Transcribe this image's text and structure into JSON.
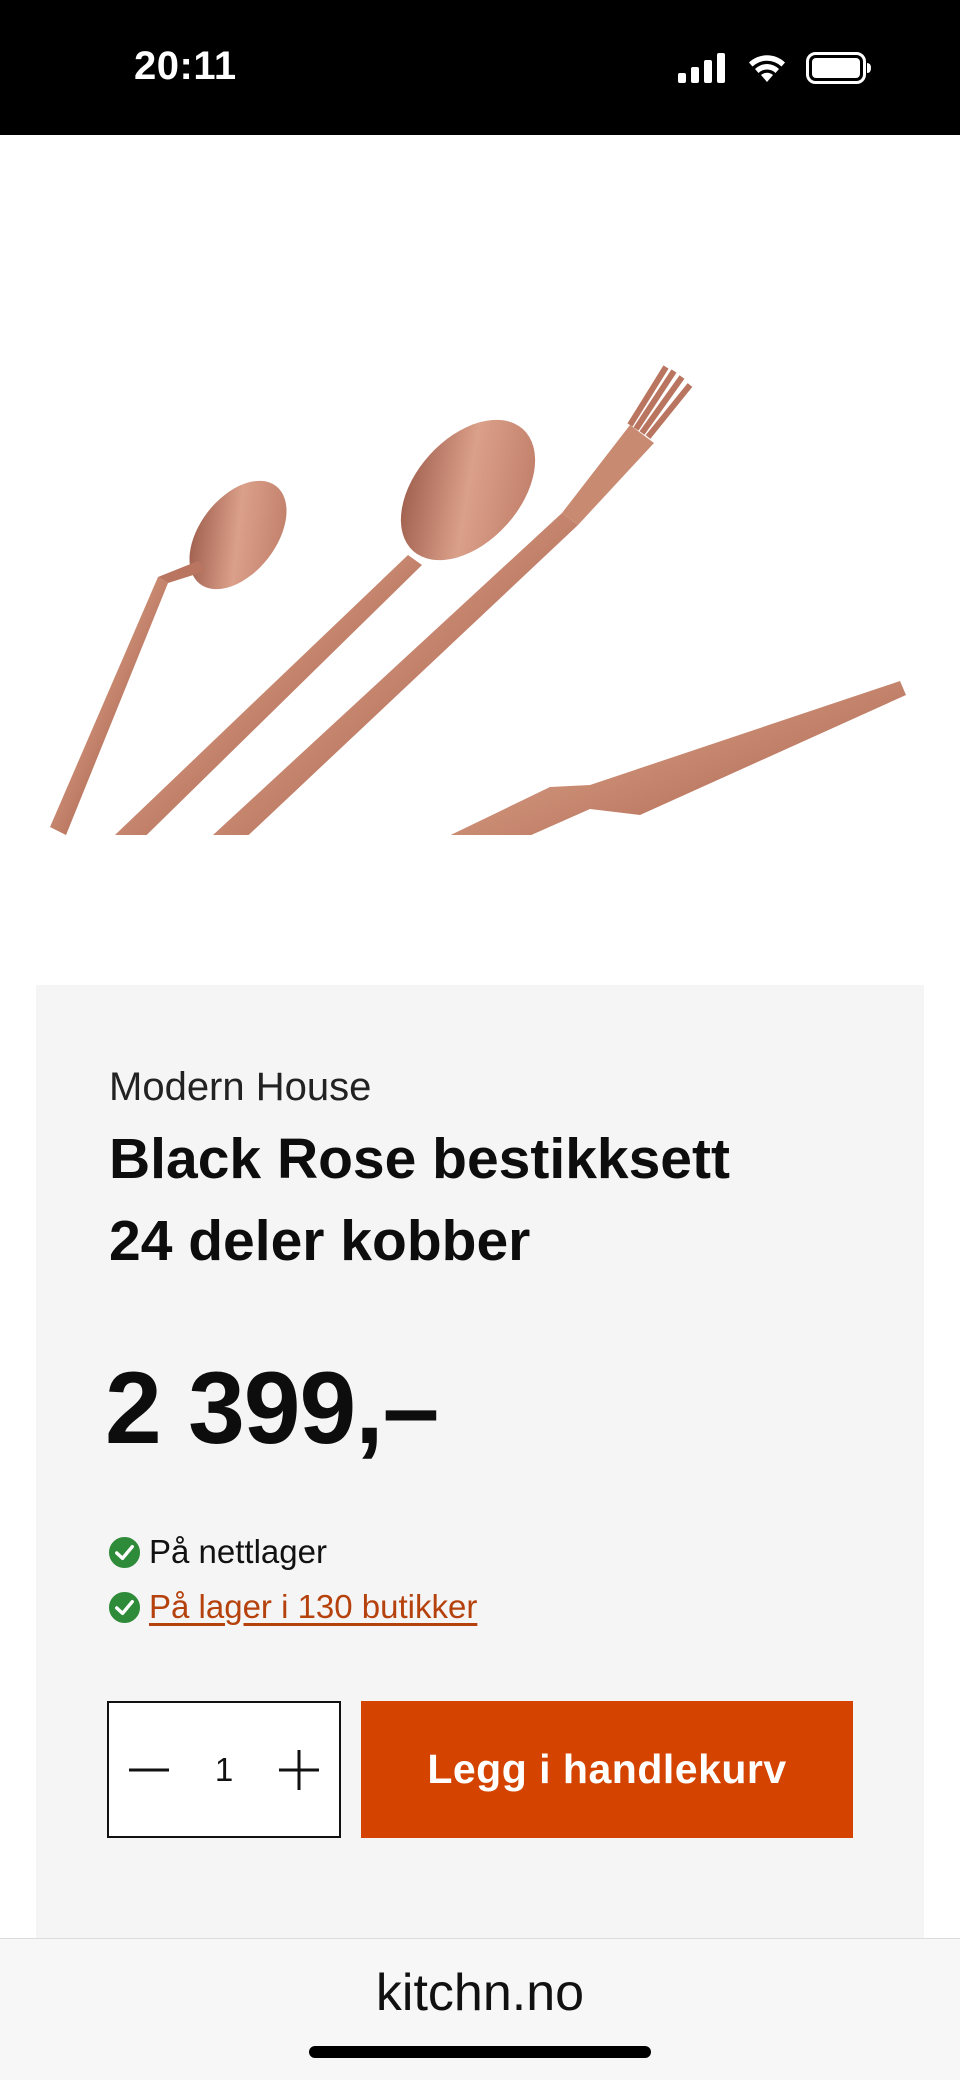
{
  "status_bar": {
    "time": "20:11",
    "icons": [
      "cellular-signal-icon",
      "wifi-icon",
      "battery-icon"
    ]
  },
  "gallery": {
    "image": "copper-cutlery-set",
    "slide_count": 3,
    "active_slide": 1,
    "favorite_icon": "heart-outline-icon"
  },
  "product": {
    "brand": "Modern House",
    "title": "Black Rose bestikksett 24 deler kobber",
    "price": "2 399,–",
    "stock_online": "På nettlager",
    "stock_stores": "På lager i 130 butikker",
    "quantity": "1",
    "add_to_cart_label": "Legg i handlekurv"
  },
  "browser": {
    "url": "kitchn.no"
  },
  "colors": {
    "accent": "#d44400",
    "link": "#b5420c",
    "check_green": "#2e8b3a",
    "card_background": "#f6f5f6"
  }
}
